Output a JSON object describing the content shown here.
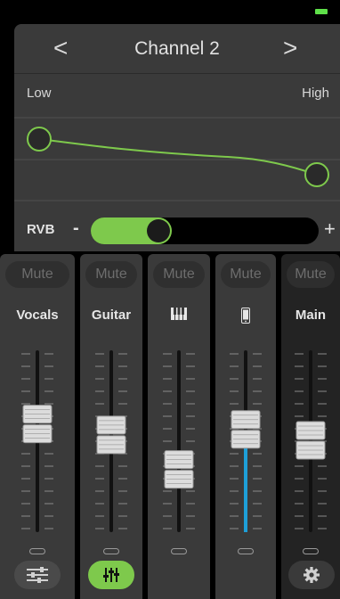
{
  "header": {
    "prev_label": "<",
    "title": "Channel 2",
    "next_label": ">"
  },
  "eq": {
    "low_label": "Low",
    "high_label": "High",
    "curve_color": "#7ec94c"
  },
  "reverb": {
    "label": "RVB",
    "minus": "-",
    "plus": "+",
    "level": 0.27,
    "fill_color": "#7ec94c"
  },
  "channels": [
    {
      "mute_label": "Mute",
      "name": "Vocals",
      "icon": null,
      "fader_level": 0.59,
      "meter_level": 0
    },
    {
      "mute_label": "Mute",
      "name": "Guitar",
      "icon": null,
      "fader_level": 0.53,
      "meter_level": 0
    },
    {
      "mute_label": "Mute",
      "name": "",
      "icon": "piano-keys-icon",
      "fader_level": 0.34,
      "meter_level": 0
    },
    {
      "mute_label": "Mute",
      "name": "",
      "icon": "smartphone-icon",
      "fader_level": 0.56,
      "meter_level": 0.56,
      "meter_color": "#1e9fd8"
    },
    {
      "mute_label": "Mute",
      "name": "Main",
      "icon": null,
      "fader_level": 0.5,
      "meter_level": 0
    }
  ],
  "bottom_buttons": [
    {
      "icon": "sliders-settings-icon"
    },
    {
      "icon": "mixer-faders-icon",
      "active": true
    },
    {
      "icon": "gear-icon"
    }
  ],
  "colors": {
    "accent": "#7ec94c",
    "meter_blue": "#1e9fd8",
    "battery": "#5fe04a"
  }
}
